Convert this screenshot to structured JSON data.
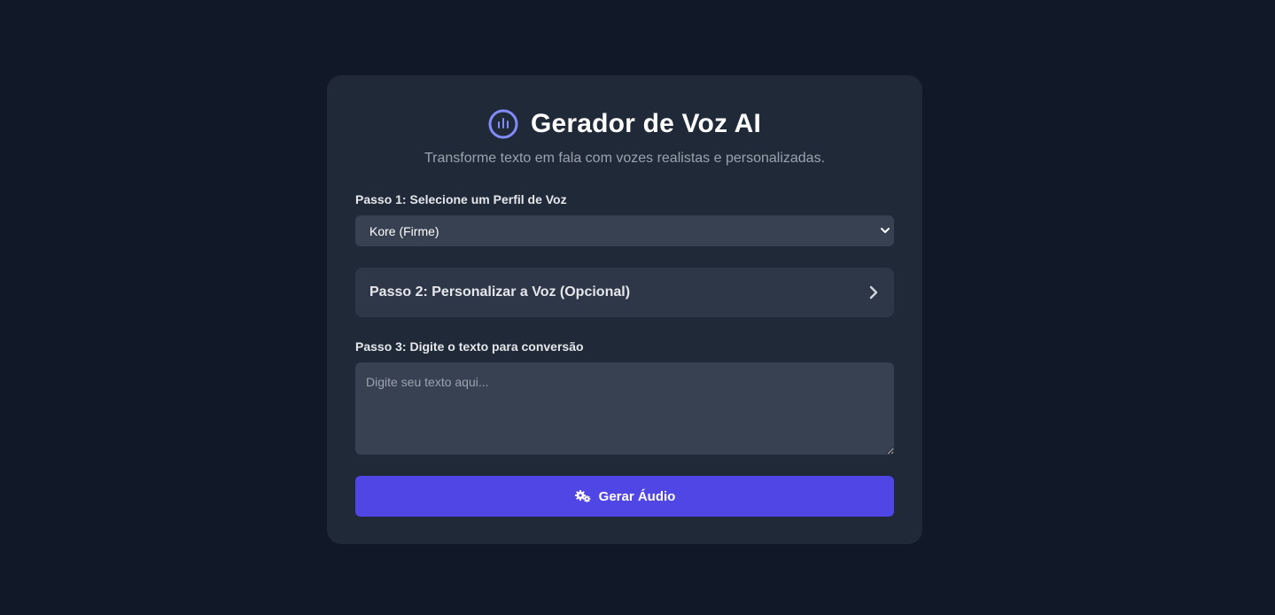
{
  "header": {
    "title": "Gerador de Voz AI",
    "subtitle": "Transforme texto em fala com vozes realistas e personalizadas.",
    "logo_icon": "audio-waveform-circle-icon",
    "accent_color": "#818cf8"
  },
  "step1": {
    "label": "Passo 1: Selecione um Perfil de Voz",
    "selected_value": "Kore (Firme)",
    "caret_icon": "chevron-down-icon"
  },
  "step2": {
    "label": "Passo 2: Personalizar a Voz (Opcional)",
    "icon": "chevron-right-icon"
  },
  "step3": {
    "label": "Passo 3: Digite o texto para conversão",
    "placeholder": "Digite seu texto aqui...",
    "value": ""
  },
  "generate_button": {
    "label": "Gerar Áudio",
    "icon": "gears-icon",
    "color": "#4f46e5"
  },
  "colors": {
    "background": "#111827",
    "card": "#1f2937",
    "input": "#374151"
  }
}
